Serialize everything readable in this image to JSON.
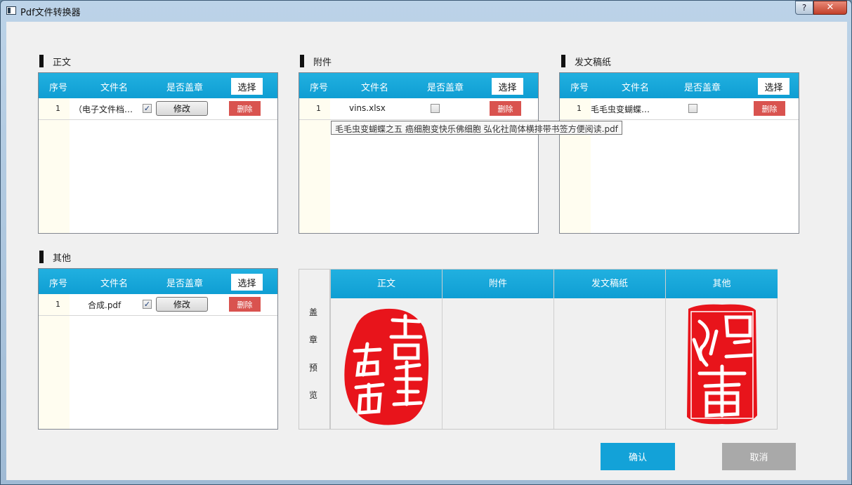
{
  "window": {
    "title": "Pdf文件转换器",
    "help": "?",
    "close": "✕"
  },
  "panels": {
    "main": {
      "label": "正文",
      "headers": {
        "no": "序号",
        "name": "文件名",
        "stamp": "是否盖章"
      },
      "select_label": "选择",
      "rows": [
        {
          "no": "1",
          "name": "（电子文件档…",
          "stamped": true,
          "edit_label": "修改",
          "delete_label": "删除"
        }
      ]
    },
    "attachment": {
      "label": "附件",
      "headers": {
        "no": "序号",
        "name": "文件名",
        "stamp": "是否盖章"
      },
      "select_label": "选择",
      "rows": [
        {
          "no": "1",
          "name": "vins.xlsx",
          "stamped": false,
          "delete_label": "删除"
        }
      ]
    },
    "draft": {
      "label": "发文稿纸",
      "headers": {
        "no": "序号",
        "name": "文件名",
        "stamp": "是否盖章"
      },
      "select_label": "选择",
      "rows": [
        {
          "no": "1",
          "name": "毛毛虫变蝴蝶…",
          "stamped": false,
          "delete_label": "删除"
        }
      ]
    },
    "other": {
      "label": "其他",
      "headers": {
        "no": "序号",
        "name": "文件名",
        "stamp": "是否盖章"
      },
      "select_label": "选择",
      "rows": [
        {
          "no": "1",
          "name": "合成.pdf",
          "stamped": true,
          "edit_label": "修改",
          "delete_label": "删除"
        }
      ]
    }
  },
  "tooltip": "毛毛虫变蝴蝶之五 癌细胞变快乐佛细胞 弘化社简体横排带书签方便阅读.pdf",
  "preview": {
    "side_chars": [
      "盖",
      "章",
      "预",
      "览"
    ],
    "columns": [
      "正文",
      "附件",
      "发文稿纸",
      "其他"
    ],
    "seal_main_text": "吉祥如意",
    "seal_other_text": "必贵"
  },
  "actions": {
    "confirm": "确认",
    "cancel": "取消"
  },
  "colors": {
    "header_blue": "#13a2d8",
    "delete_red": "#d9534f",
    "seal_red": "#e8141b"
  }
}
